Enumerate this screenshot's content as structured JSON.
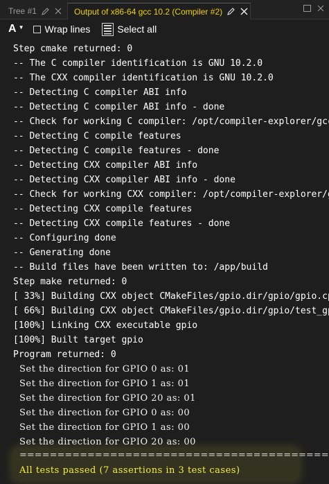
{
  "tabs": [
    {
      "label": "Tree #1",
      "active": false
    },
    {
      "label": "Output of x86-64 gcc 10.2 (Compiler #2)",
      "active": true
    }
  ],
  "toolbar": {
    "font_label": "A",
    "wrap_lines_label": "Wrap lines",
    "wrap_lines_checked": false,
    "select_all_label": "Select all"
  },
  "colors": {
    "active_tab_text": "#f0d000",
    "background": "#1e1e1e",
    "pass_text": "#f6ef3d"
  },
  "output": {
    "lines": [
      "Step cmake returned: 0",
      "-- The C compiler identification is GNU 10.2.0",
      "-- The CXX compiler identification is GNU 10.2.0",
      "-- Detecting C compiler ABI info",
      "-- Detecting C compiler ABI info - done",
      "-- Check for working C compiler: /opt/compiler-explorer/gcc",
      "-- Detecting C compile features",
      "-- Detecting C compile features - done",
      "-- Detecting CXX compiler ABI info",
      "-- Detecting CXX compiler ABI info - done",
      "-- Check for working CXX compiler: /opt/compiler-explorer/g",
      "-- Detecting CXX compile features",
      "-- Detecting CXX compile features - done",
      "-- Configuring done",
      "-- Generating done",
      "-- Build files have been written to: /app/build",
      "Step make returned: 0",
      "[ 33%] Building CXX object CMakeFiles/gpio.dir/gpio/gpio.cp",
      "[ 66%] Building CXX object CMakeFiles/gpio.dir/gpio/test_gp",
      "[100%] Linking CXX executable gpio",
      "[100%] Built target gpio",
      "Program returned: 0"
    ],
    "program_lines": [
      "Set the direction for GPIO 0 as: 01",
      "Set the direction for GPIO 1 as: 01",
      "Set the direction for GPIO 20 as: 01",
      "Set the direction for GPIO 0 as: 00",
      "Set the direction for GPIO 1 as: 00",
      "Set the direction for GPIO 20 as: 00"
    ],
    "separator": "=========================================================",
    "result": "All tests passed (7 assertions in 3 test cases)"
  }
}
